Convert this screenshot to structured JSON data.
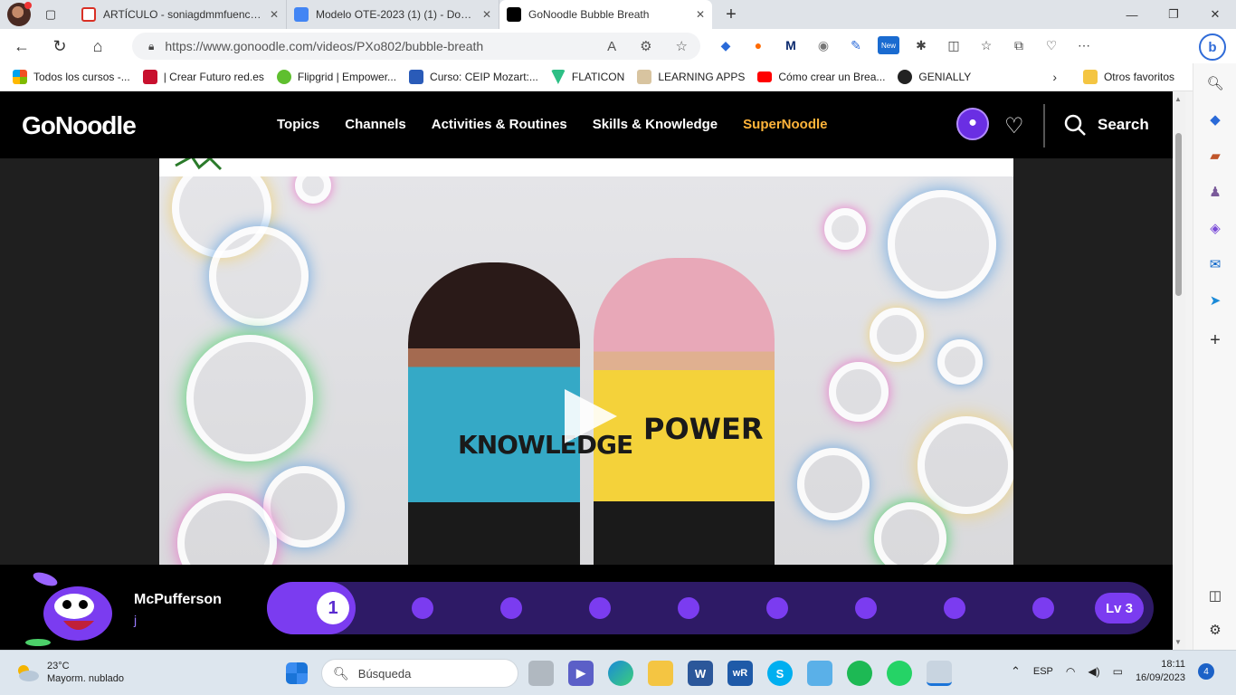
{
  "browser": {
    "tabs": [
      {
        "title": "ARTÍCULO - soniagdmmfuencisla",
        "icon": "gmail-icon",
        "color": "#d93025"
      },
      {
        "title": "Modelo OTE-2023 (1) (1) - Docum",
        "icon": "docs-icon",
        "color": "#4285f4"
      },
      {
        "title": "GoNoodle Bubble Breath",
        "icon": "gonoodle-icon",
        "color": "#000000"
      }
    ],
    "url": "https://www.gonoodle.com/videos/PXo802/bubble-breath",
    "bookmarks": [
      {
        "label": "Todos los cursos -...",
        "color": "#f25022"
      },
      {
        "label": "| Crear Futuro red.es",
        "color": "#c8102e"
      },
      {
        "label": "Flipgrid | Empower...",
        "color": "#5fbf2f"
      },
      {
        "label": "Curso: CEIP Mozart:...",
        "color": "#2a5bb8"
      },
      {
        "label": "FLATICON",
        "color": "#2dbf85"
      },
      {
        "label": "LEARNING APPS",
        "color": "#b08a55"
      },
      {
        "label": "Cómo crear un Brea...",
        "color": "#ff0000"
      },
      {
        "label": "GENIALLY",
        "color": "#222222"
      }
    ],
    "other_favorites": "Otros favoritos",
    "ext_new_badge": "New"
  },
  "site": {
    "logo": "GoNoodle",
    "nav": [
      "Topics",
      "Channels",
      "Activities & Routines",
      "Skills & Knowledge"
    ],
    "super_nav": "SuperNoodle",
    "search_label": "Search"
  },
  "video": {
    "title": "Bubble Breath",
    "shirt_left": "KNOWLEDGE",
    "shirt_right": "POWER"
  },
  "progress": {
    "champ_name": "McPufferson",
    "champ_sub": "j",
    "current_level_step": "1",
    "level_label": "Lv 3",
    "steps_total": 10,
    "steps_done": 1
  },
  "taskbar": {
    "temp": "23°C",
    "weather": "Mayorm. nublado",
    "search_placeholder": "Búsqueda",
    "lang": "ESP",
    "time": "18:11",
    "date": "16/09/2023",
    "notifications": "4"
  },
  "colors": {
    "accent": "#7b3cf0",
    "super": "#ffb43a",
    "track": "#2e1a66"
  }
}
